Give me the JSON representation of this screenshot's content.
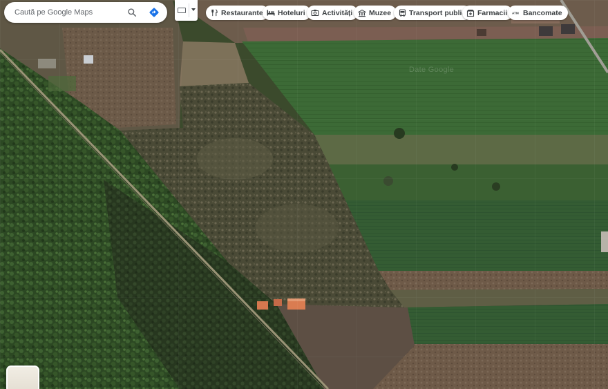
{
  "search": {
    "placeholder": "Caută pe Google Maps",
    "search_icon": "search-icon",
    "directions_icon": "directions-icon"
  },
  "layer_switch": {
    "icon": "keyboard-icon"
  },
  "chips": [
    {
      "label": "Restaurante",
      "icon": "fork-knife-icon"
    },
    {
      "label": "Hoteluri",
      "icon": "bed-icon"
    },
    {
      "label": "Activități",
      "icon": "camera-icon"
    },
    {
      "label": "Muzee",
      "icon": "museum-icon"
    },
    {
      "label": "Transport public",
      "icon": "bus-icon"
    },
    {
      "label": "Farmacii",
      "icon": "pharmacy-icon"
    },
    {
      "label": "Bancomate",
      "icon": "atm-icon"
    }
  ],
  "map": {
    "watermark": "Date Google",
    "type": "satellite"
  },
  "colors": {
    "accent": "#1a73e8",
    "chip_text": "#3c4043",
    "forest": "#2f4a25",
    "field_green": "#3b6a34"
  }
}
